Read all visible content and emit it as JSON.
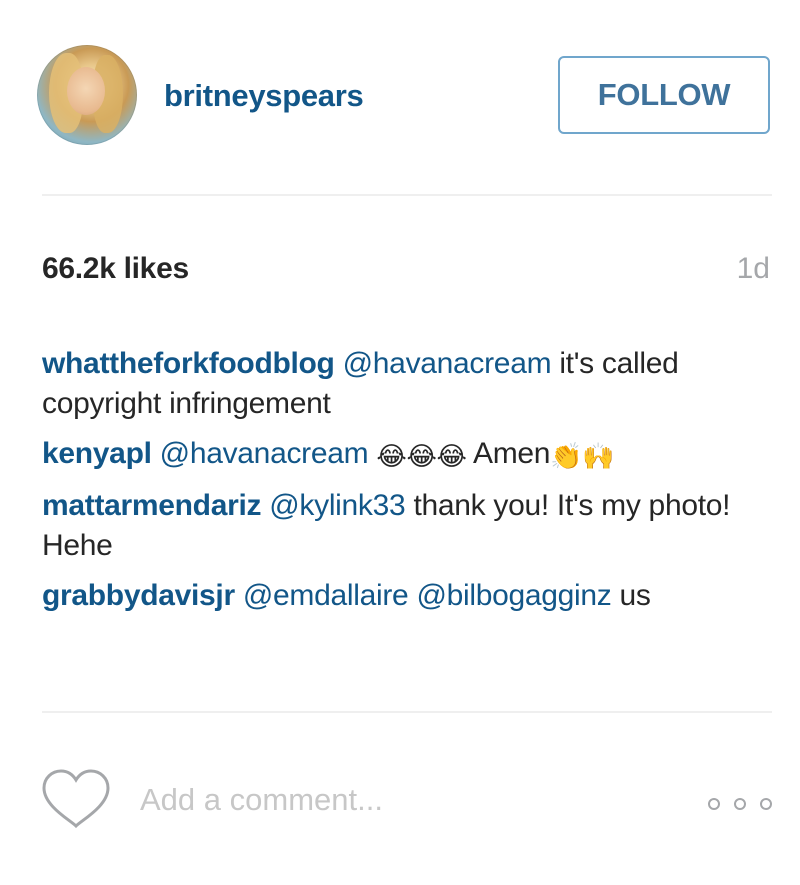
{
  "header": {
    "username": "britneyspears",
    "follow_label": "FOLLOW"
  },
  "stats": {
    "likes": "66.2k likes",
    "timestamp": "1d"
  },
  "comments": [
    {
      "author": "whattheforkfoodblog",
      "mention": "@havanacream",
      "text": " it's called copyright infringement"
    },
    {
      "author": "kenyapl",
      "mention": "@havanacream",
      "emoji1": "😂😂😂",
      "text": " Amen",
      "emoji2": "👏🙌"
    },
    {
      "author": "mattarmendariz",
      "mention": "@kylink33",
      "text": " thank you! It's my photo! Hehe"
    },
    {
      "author": "grabbydavisjr",
      "mention": "@emdallaire @bilbogagginz",
      "text": " us"
    }
  ],
  "footer": {
    "comment_placeholder": "Add a comment...",
    "heart_icon": "heart-outline-icon",
    "more_icon": "more-options-icon"
  },
  "colors": {
    "link_blue": "#125688",
    "follow_blue": "#3f729b",
    "follow_border": "#70a6cc",
    "muted_gray": "#a5a7aa",
    "placeholder_gray": "#c7c7c7"
  }
}
